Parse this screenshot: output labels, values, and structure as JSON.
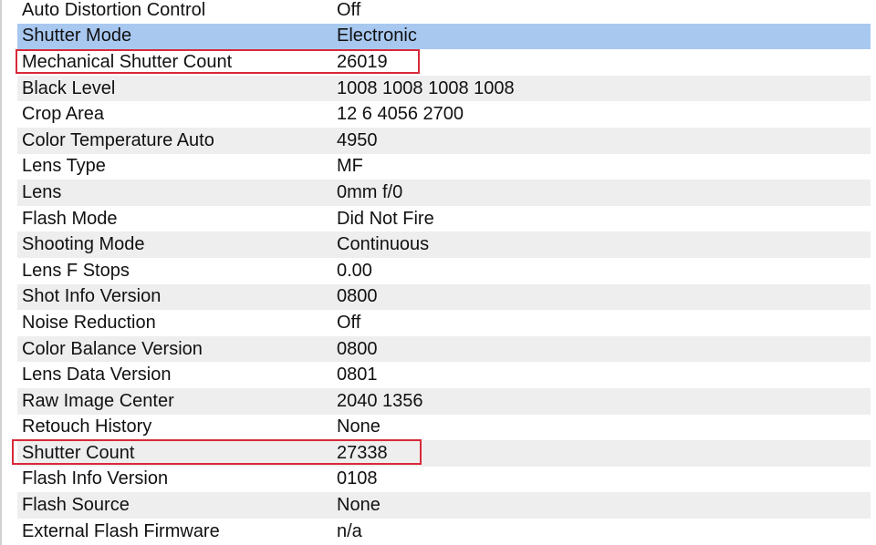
{
  "rows": [
    {
      "name": "Auto Distortion Control",
      "value": "Off",
      "selected": false,
      "highlighted": false
    },
    {
      "name": "Shutter Mode",
      "value": "Electronic",
      "selected": true,
      "highlighted": false
    },
    {
      "name": "Mechanical Shutter Count",
      "value": "26019",
      "selected": false,
      "highlighted": true
    },
    {
      "name": "Black Level",
      "value": "1008 1008 1008 1008",
      "selected": false,
      "highlighted": false
    },
    {
      "name": "Crop Area",
      "value": "12 6 4056 2700",
      "selected": false,
      "highlighted": false
    },
    {
      "name": "Color Temperature Auto",
      "value": "4950",
      "selected": false,
      "highlighted": false
    },
    {
      "name": "Lens Type",
      "value": "MF",
      "selected": false,
      "highlighted": false
    },
    {
      "name": "Lens",
      "value": "0mm f/0",
      "selected": false,
      "highlighted": false
    },
    {
      "name": "Flash Mode",
      "value": "Did Not Fire",
      "selected": false,
      "highlighted": false
    },
    {
      "name": "Shooting Mode",
      "value": "Continuous",
      "selected": false,
      "highlighted": false
    },
    {
      "name": "Lens F Stops",
      "value": "0.00",
      "selected": false,
      "highlighted": false
    },
    {
      "name": "Shot Info Version",
      "value": "0800",
      "selected": false,
      "highlighted": false
    },
    {
      "name": "Noise Reduction",
      "value": "Off",
      "selected": false,
      "highlighted": false
    },
    {
      "name": "Color Balance Version",
      "value": "0800",
      "selected": false,
      "highlighted": false
    },
    {
      "name": "Lens Data Version",
      "value": "0801",
      "selected": false,
      "highlighted": false
    },
    {
      "name": "Raw Image Center",
      "value": "2040 1356",
      "selected": false,
      "highlighted": false
    },
    {
      "name": "Retouch History",
      "value": "None",
      "selected": false,
      "highlighted": false
    },
    {
      "name": "Shutter Count",
      "value": "27338",
      "selected": false,
      "highlighted": true
    },
    {
      "name": "Flash Info Version",
      "value": "0108",
      "selected": false,
      "highlighted": false
    },
    {
      "name": "Flash Source",
      "value": "None",
      "selected": false,
      "highlighted": false
    },
    {
      "name": "External Flash Firmware",
      "value": "n/a",
      "selected": false,
      "highlighted": false
    }
  ],
  "colors": {
    "selected_row": "#a8c8f0",
    "alt_row": "#eeeeee",
    "highlight_box": "#d8293a"
  }
}
